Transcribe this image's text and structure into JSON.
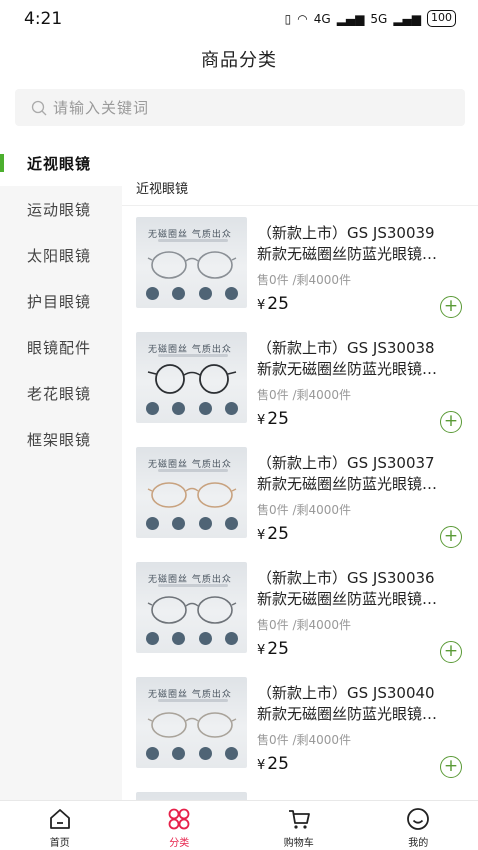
{
  "status_bar": {
    "time": "4:21",
    "network_1": "4G",
    "network_2": "5G",
    "battery": "100"
  },
  "page_title": "商品分类",
  "search": {
    "placeholder": "请输入关键词"
  },
  "sidebar": {
    "categories": [
      {
        "label": "近视眼镜",
        "active": true
      },
      {
        "label": "运动眼镜",
        "active": false
      },
      {
        "label": "太阳眼镜",
        "active": false
      },
      {
        "label": "护目眼镜",
        "active": false
      },
      {
        "label": "眼镜配件",
        "active": false
      },
      {
        "label": "老花眼镜",
        "active": false
      },
      {
        "label": "框架眼镜",
        "active": false
      }
    ]
  },
  "section_title": "近视眼镜",
  "thumb_text": "无磁圈丝 气质出众",
  "products": [
    {
      "name_line1": "（新款上市）GS JS30039",
      "name_line2": "新款无磁圈丝防蓝光眼镜…",
      "stock": "售0件 /剩4000件",
      "currency": "¥",
      "price": "25"
    },
    {
      "name_line1": "（新款上市）GS JS30038",
      "name_line2": "新款无磁圈丝防蓝光眼镜…",
      "stock": "售0件 /剩4000件",
      "currency": "¥",
      "price": "25"
    },
    {
      "name_line1": "（新款上市）GS JS30037",
      "name_line2": "新款无磁圈丝防蓝光眼镜…",
      "stock": "售0件 /剩4000件",
      "currency": "¥",
      "price": "25"
    },
    {
      "name_line1": "（新款上市）GS JS30036",
      "name_line2": "新款无磁圈丝防蓝光眼镜…",
      "stock": "售0件 /剩4000件",
      "currency": "¥",
      "price": "25"
    },
    {
      "name_line1": "（新款上市）GS JS30040",
      "name_line2": "新款无磁圈丝防蓝光眼镜…",
      "stock": "售0件 /剩4000件",
      "currency": "¥",
      "price": "25"
    }
  ],
  "add_icon": "plus-circle-icon",
  "bottom_nav": [
    {
      "label": "首页",
      "icon": "home-icon"
    },
    {
      "label": "分类",
      "icon": "category-icon",
      "active": true
    },
    {
      "label": "购物车",
      "icon": "cart-icon"
    },
    {
      "label": "我的",
      "icon": "profile-icon"
    }
  ],
  "colors": {
    "accent_green": "#4caf2e",
    "active_tab": "#e6214a",
    "sidebar_bg": "#f6f6f6"
  }
}
